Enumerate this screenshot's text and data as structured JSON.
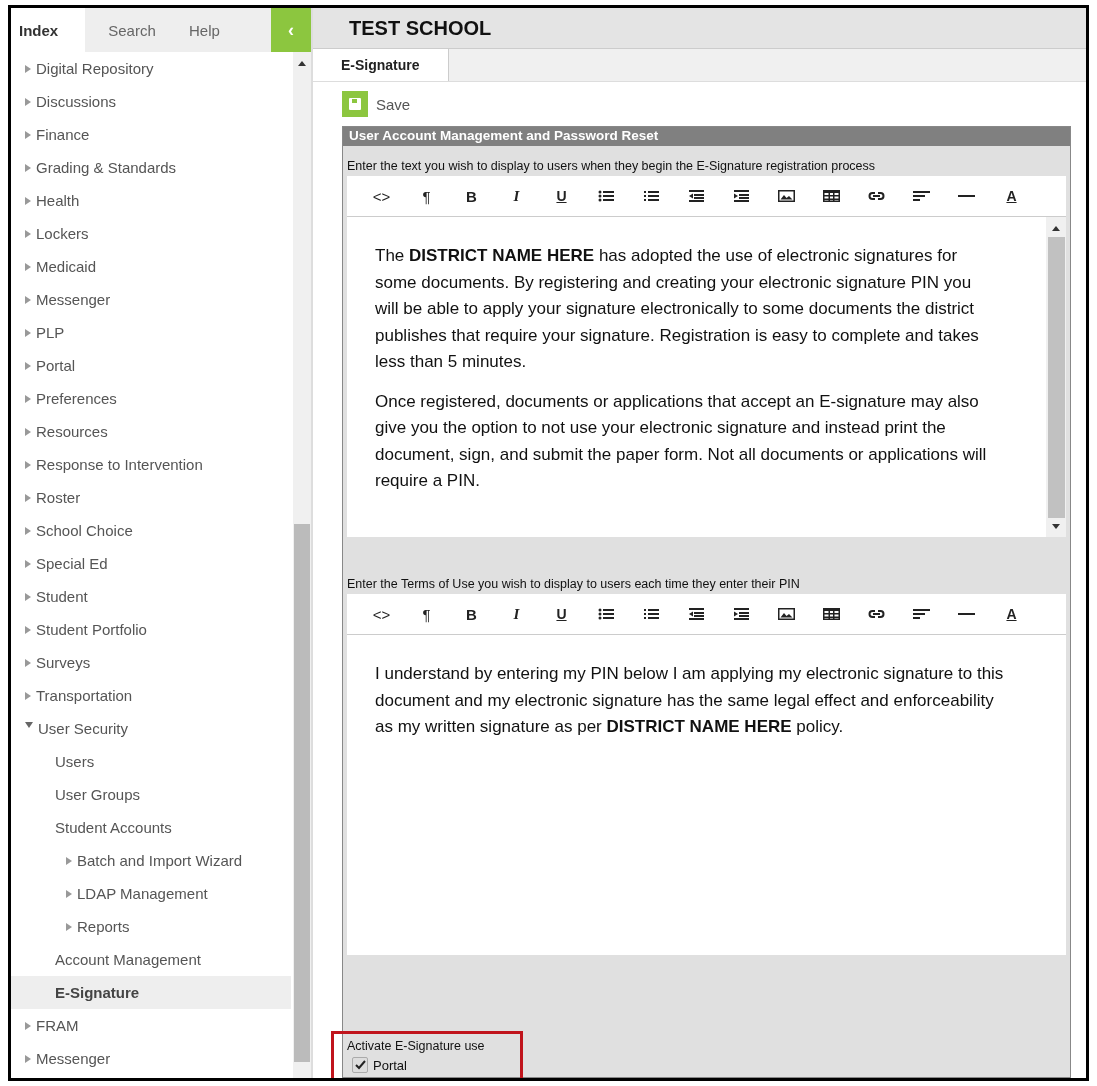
{
  "sidebar": {
    "tabs": [
      {
        "label": "Index",
        "selected": true
      },
      {
        "label": "Search",
        "selected": false
      },
      {
        "label": "Help",
        "selected": false
      }
    ],
    "collapse_button": "‹",
    "tree": [
      {
        "children": [
          {
            "label": "Digital Repository",
            "expanded": false,
            "selected": false
          },
          {
            "label": "Discussions",
            "expanded": false,
            "selected": false
          },
          {
            "label": "Finance",
            "expanded": false,
            "selected": false
          },
          {
            "label": "Grading & Standards",
            "expanded": false,
            "selected": false
          },
          {
            "label": "Health",
            "expanded": false,
            "selected": false
          },
          {
            "label": "Lockers",
            "expanded": false,
            "selected": false
          },
          {
            "label": "Medicaid",
            "expanded": false,
            "selected": false
          },
          {
            "label": "Messenger",
            "expanded": false,
            "selected": false
          },
          {
            "label": "PLP",
            "expanded": false,
            "selected": false
          },
          {
            "label": "Portal",
            "expanded": false,
            "selected": false
          },
          {
            "label": "Preferences",
            "expanded": false,
            "selected": false
          },
          {
            "label": "Resources",
            "expanded": false,
            "selected": false
          },
          {
            "label": "Response to Intervention",
            "expanded": false,
            "selected": false
          },
          {
            "label": "Roster",
            "expanded": false,
            "selected": false
          },
          {
            "label": "School Choice",
            "expanded": false,
            "selected": false
          },
          {
            "label": "Special Ed",
            "expanded": false,
            "selected": false
          },
          {
            "label": "Student",
            "expanded": false,
            "selected": false
          },
          {
            "label": "Student Portfolio",
            "expanded": false,
            "selected": false
          },
          {
            "label": "Surveys",
            "expanded": false,
            "selected": false
          },
          {
            "label": "Transportation",
            "expanded": false,
            "selected": false
          },
          {
            "label": "User Security",
            "expanded": true,
            "selected": false,
            "children": [
              {
                "label": "Users",
                "selected": false
              },
              {
                "label": "User Groups",
                "selected": false
              },
              {
                "label": "Student Accounts",
                "selected": false
              },
              {
                "label": "Batch and Import Wizard",
                "expanded": false,
                "selected": false
              },
              {
                "label": "LDAP Management",
                "expanded": false,
                "selected": false
              },
              {
                "label": "Reports",
                "expanded": false,
                "selected": false
              },
              {
                "label": "Account Management",
                "selected": false
              },
              {
                "label": "E-Signature",
                "selected": true
              }
            ]
          }
        ]
      },
      {
        "label": "FRAM",
        "expanded": false,
        "selected": false
      },
      {
        "label": "Messenger",
        "expanded": false,
        "selected": false
      }
    ]
  },
  "header": {
    "title": "TEST SCHOOL"
  },
  "tabs": [
    {
      "label": "E-Signature",
      "selected": true
    }
  ],
  "save_button": {
    "label": "Save"
  },
  "panel": {
    "title": "User Account Management and Password Reset",
    "editors": [
      {
        "label": "Enter the text you wish to display to users when they begin the E-Signature registration process",
        "toolbar": [
          {
            "kind": "glyph",
            "text": "<>"
          },
          {
            "kind": "glyph",
            "text": "¶"
          },
          {
            "kind": "bold",
            "text": "B"
          },
          {
            "kind": "italic",
            "text": "I"
          },
          {
            "kind": "underline",
            "text": "U"
          },
          {
            "kind": "bullets"
          },
          {
            "kind": "numbers"
          },
          {
            "kind": "outdent"
          },
          {
            "kind": "indent"
          },
          {
            "kind": "image"
          },
          {
            "kind": "table"
          },
          {
            "kind": "link"
          },
          {
            "kind": "align"
          },
          {
            "kind": "rule"
          },
          {
            "kind": "color",
            "text": "A"
          }
        ],
        "scrollable": true,
        "paragraphs": [
          "The **DISTRICT NAME HERE** has adopted the use of electronic signatures for some documents. By registering and creating your electronic signature PIN you will be able to apply your signature electronically to some documents the district publishes that require your signature. Registration is easy to complete and takes less than 5 minutes.",
          "Once registered, documents or applications that accept an E-signature may also give you the option to not use your electronic signature and instead print the document, sign, and submit the paper form. Not all documents or applications will require a PIN."
        ]
      },
      {
        "label": "Enter the Terms of Use you wish to display to users each time they enter their PIN",
        "toolbar": [
          {
            "kind": "glyph",
            "text": "<>"
          },
          {
            "kind": "glyph",
            "text": "¶"
          },
          {
            "kind": "bold",
            "text": "B"
          },
          {
            "kind": "italic",
            "text": "I"
          },
          {
            "kind": "underline",
            "text": "U"
          },
          {
            "kind": "bullets"
          },
          {
            "kind": "numbers"
          },
          {
            "kind": "outdent"
          },
          {
            "kind": "indent"
          },
          {
            "kind": "image"
          },
          {
            "kind": "table"
          },
          {
            "kind": "link"
          },
          {
            "kind": "align"
          },
          {
            "kind": "rule"
          },
          {
            "kind": "color",
            "text": "A"
          }
        ],
        "scrollable": false,
        "paragraphs": [
          "I understand by entering my PIN below I am applying my electronic signature to this document and my electronic signature has the same legal effect and enforceability as my written signature as per **DISTRICT NAME HERE** policy."
        ]
      }
    ],
    "activation": {
      "label": "Activate E-Signature use",
      "highlighted": true,
      "options": [
        {
          "label": "Portal",
          "checked": true
        }
      ]
    }
  }
}
